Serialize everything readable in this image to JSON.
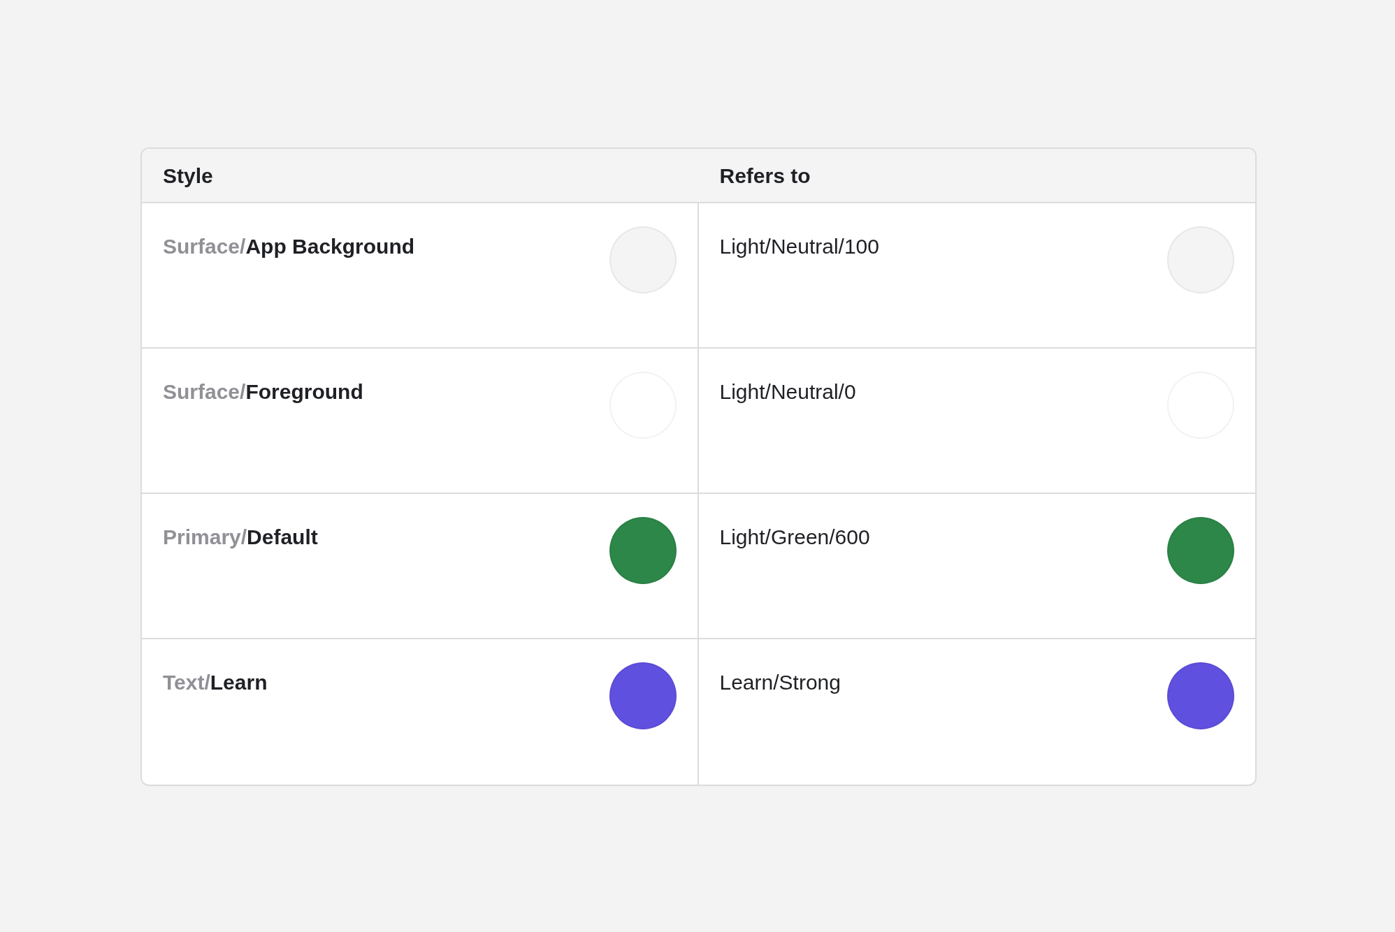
{
  "table": {
    "columns": [
      "Style",
      "Refers to"
    ],
    "rows": [
      {
        "style": {
          "group": "Surface/",
          "name": "App Background",
          "color": "#f4f4f4"
        },
        "refers_to": {
          "text": "Light/Neutral/100",
          "color": "#f4f4f4"
        }
      },
      {
        "style": {
          "group": "Surface/",
          "name": "Foreground",
          "color": "#ffffff"
        },
        "refers_to": {
          "text": "Light/Neutral/0",
          "color": "#ffffff"
        }
      },
      {
        "style": {
          "group": "Primary/",
          "name": "Default",
          "color": "#2d8749"
        },
        "refers_to": {
          "text": "Light/Green/600",
          "color": "#2d8749"
        }
      },
      {
        "style": {
          "group": "Text/",
          "name": "Learn",
          "color": "#6050e0"
        },
        "refers_to": {
          "text": "Learn/Strong",
          "color": "#6050e0"
        }
      }
    ]
  }
}
